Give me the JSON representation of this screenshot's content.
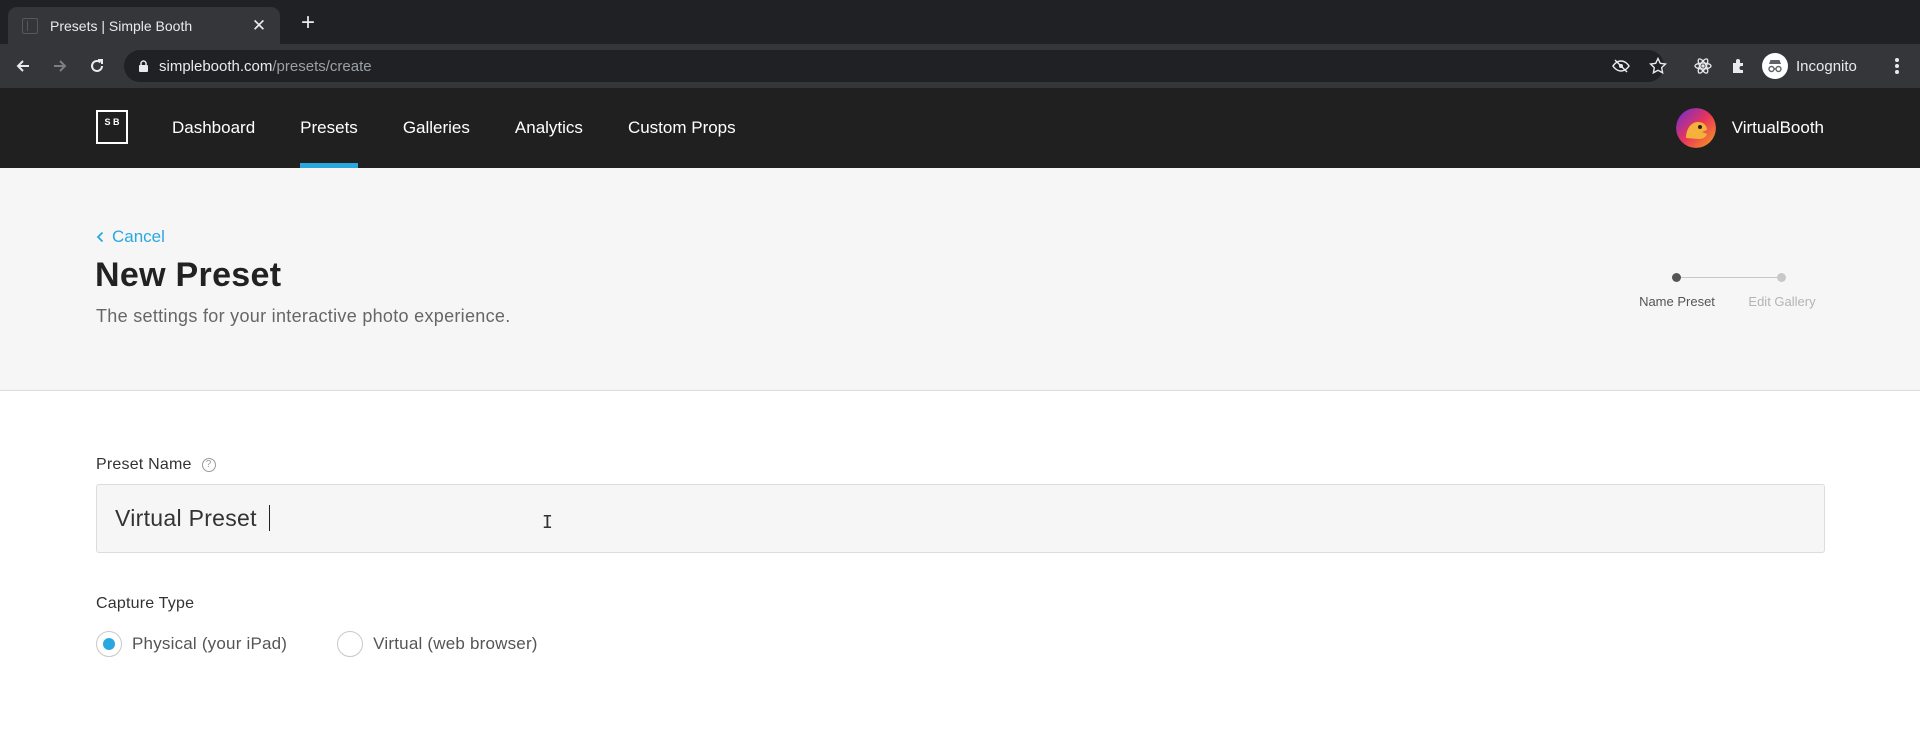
{
  "browser": {
    "tab_title": "Presets | Simple Booth",
    "url_host": "simplebooth.com",
    "url_path": "/presets/create",
    "profile_label": "Incognito"
  },
  "nav": {
    "logo_text": "S B",
    "items": [
      {
        "label": "Dashboard",
        "active": false
      },
      {
        "label": "Presets",
        "active": true
      },
      {
        "label": "Galleries",
        "active": false
      },
      {
        "label": "Analytics",
        "active": false
      },
      {
        "label": "Custom Props",
        "active": false
      }
    ],
    "user_name": "VirtualBooth"
  },
  "header": {
    "cancel_label": "Cancel",
    "title": "New Preset",
    "subtitle": "The settings for your interactive photo experience.",
    "steps": [
      {
        "label": "Name Preset",
        "active": true
      },
      {
        "label": "Edit Gallery",
        "active": false
      }
    ]
  },
  "form": {
    "preset_name_label": "Preset Name",
    "preset_name_value": "Virtual Preset",
    "capture_type_label": "Capture Type",
    "capture_options": [
      {
        "label": "Physical (your iPad)",
        "checked": true
      },
      {
        "label": "Virtual (web browser)",
        "checked": false
      }
    ]
  },
  "colors": {
    "accent": "#29a8e0",
    "nav_bg": "#202020",
    "header_bg": "#f6f6f6"
  }
}
